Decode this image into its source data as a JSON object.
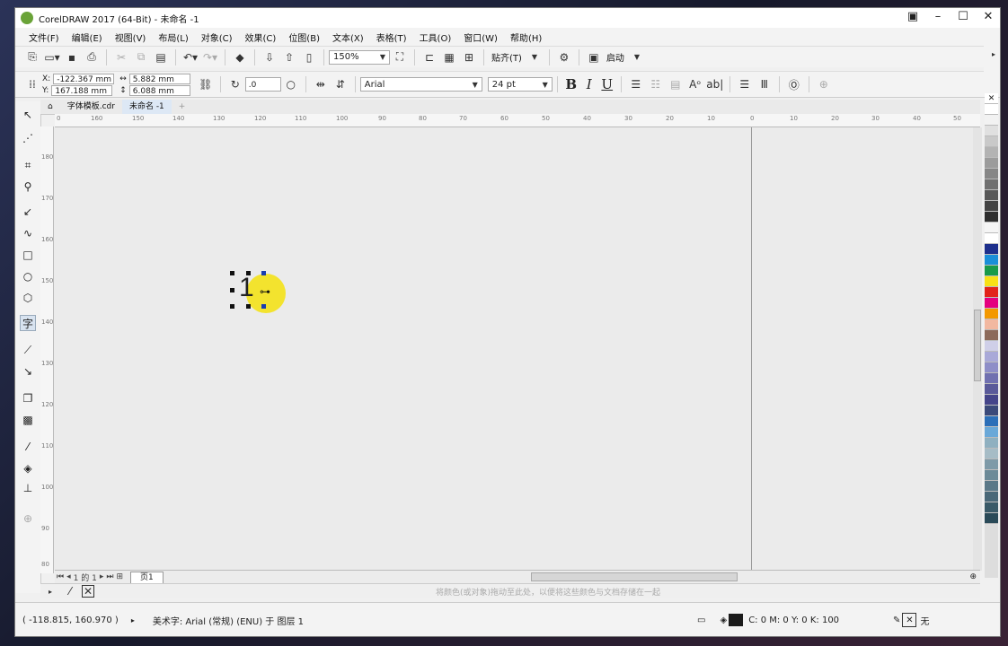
{
  "window": {
    "title": "CorelDRAW 2017 (64-Bit) - 未命名 -1",
    "controls": {
      "minimize": "–",
      "maximize": "☐",
      "close": "✕"
    }
  },
  "menu": [
    "文件(F)",
    "编辑(E)",
    "视图(V)",
    "布局(L)",
    "对象(C)",
    "效果(C)",
    "位图(B)",
    "文本(X)",
    "表格(T)",
    "工具(O)",
    "窗口(W)",
    "帮助(H)"
  ],
  "toolbar": {
    "zoom": "150%",
    "snap_label": "贴齐(T)",
    "launch_label": "启动"
  },
  "property_bar": {
    "x_label": "X:",
    "x_value": "-122.367 mm",
    "y_label": "Y:",
    "y_value": "167.188 mm",
    "width_value": "5.882 mm",
    "height_value": "6.088 mm",
    "rotation": ".0",
    "font": "Arial",
    "font_size": "24 pt",
    "bold": "B",
    "italic": "I",
    "underline": "U"
  },
  "tabs": [
    {
      "label": "字体模板.cdr",
      "active": false
    },
    {
      "label": "未命名 -1",
      "active": true
    }
  ],
  "ruler": {
    "h_ticks": [
      "0",
      "160",
      "150",
      "140",
      "130",
      "120",
      "110",
      "100",
      "90",
      "80",
      "70",
      "60",
      "50",
      "40",
      "30",
      "20",
      "10",
      "0",
      "10",
      "20",
      "30",
      "40",
      "50"
    ],
    "v_ticks": [
      "180",
      "170",
      "160",
      "150",
      "140",
      "130",
      "120",
      "110",
      "100",
      "90",
      "80"
    ]
  },
  "canvas": {
    "text_object": "1"
  },
  "page_nav": {
    "page_of": "1 的 1",
    "page_tab": "页1"
  },
  "color_hint": "将颜色(或对象)拖动至此处，以便将这些颜色与文档存储在一起",
  "status": {
    "cursor_coords": "( -118.815, 160.970 )",
    "object_info": "美术字: Arial (常规) (ENU) 于 图层 1",
    "fill_info": "C: 0 M: 0 Y: 0 K: 100",
    "outline_info": "无"
  },
  "palette_colors": [
    "#ffffff",
    "#f2f2f2",
    "#e0e0e0",
    "#c9c9c9",
    "#b3b3b3",
    "#9c9c9c",
    "#878787",
    "#707070",
    "#595959",
    "#444444",
    "#2e2e2e",
    "#f5f5f5",
    "#ffffff",
    "#1d2f8c",
    "#1a8fd8",
    "#1a9a4a",
    "#f8e016",
    "#e2231a",
    "#e4007f",
    "#f39800",
    "#f2b8a0",
    "#8c6a5a",
    "#cfcfe8",
    "#a9a9d8",
    "#8e8ec8",
    "#7070b0",
    "#5a5a9a",
    "#45458a",
    "#3b4a7a",
    "#2c6fb8",
    "#6aa8d8",
    "#8fb0c0",
    "#a6bcc6",
    "#7e9aa8",
    "#6c8a98",
    "#5a7888",
    "#4a6878",
    "#3a5a68",
    "#2a4a58"
  ]
}
